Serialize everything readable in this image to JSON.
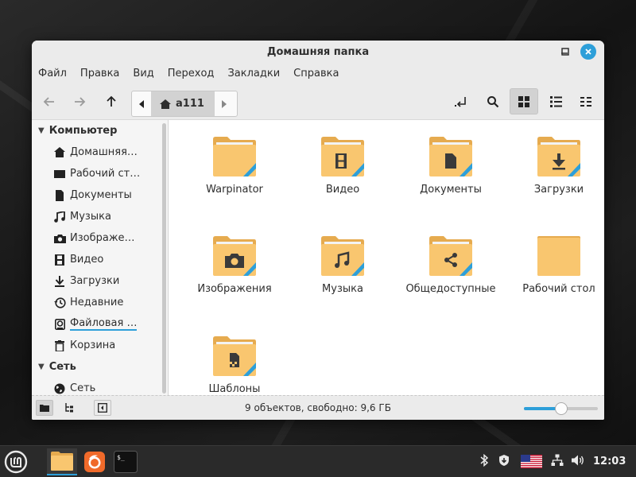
{
  "window": {
    "title": "Домашняя папка"
  },
  "menubar": [
    "Файл",
    "Правка",
    "Вид",
    "Переход",
    "Закладки",
    "Справка"
  ],
  "pathbar": {
    "crumb": "a111"
  },
  "sidebar": {
    "computer_header": "Компьютер",
    "computer_items": [
      {
        "label": "Домашняя…",
        "icon": "home-icon"
      },
      {
        "label": "Рабочий ст…",
        "icon": "desktop-icon"
      },
      {
        "label": "Документы",
        "icon": "document-icon"
      },
      {
        "label": "Музыка",
        "icon": "music-icon"
      },
      {
        "label": "Изображе…",
        "icon": "camera-icon"
      },
      {
        "label": "Видео",
        "icon": "film-icon"
      },
      {
        "label": "Загрузки",
        "icon": "download-icon"
      },
      {
        "label": "Недавние",
        "icon": "clock-icon"
      },
      {
        "label": "Файловая …",
        "icon": "disk-icon"
      },
      {
        "label": "Корзина",
        "icon": "trash-icon"
      }
    ],
    "network_header": "Сеть",
    "network_items": [
      {
        "label": "Сеть",
        "icon": "globe-icon"
      }
    ]
  },
  "files": [
    {
      "name": "Warpinator",
      "emblem": "none"
    },
    {
      "name": "Видео",
      "emblem": "film"
    },
    {
      "name": "Документы",
      "emblem": "document"
    },
    {
      "name": "Загрузки",
      "emblem": "download"
    },
    {
      "name": "Изображения",
      "emblem": "camera"
    },
    {
      "name": "Музыка",
      "emblem": "music"
    },
    {
      "name": "Общедоступные",
      "emblem": "share"
    },
    {
      "name": "Рабочий стол",
      "emblem": "desktop"
    },
    {
      "name": "Шаблоны",
      "emblem": "template"
    }
  ],
  "statusbar": {
    "text": "9 объектов, свободно: 9,6 ГБ",
    "zoom_level": 0.5
  },
  "taskbar": {
    "clock": "12:03"
  },
  "colors": {
    "accent": "#2d9fd9",
    "folder": "#f9c66f",
    "folder_tab": "#e6ab4f"
  }
}
